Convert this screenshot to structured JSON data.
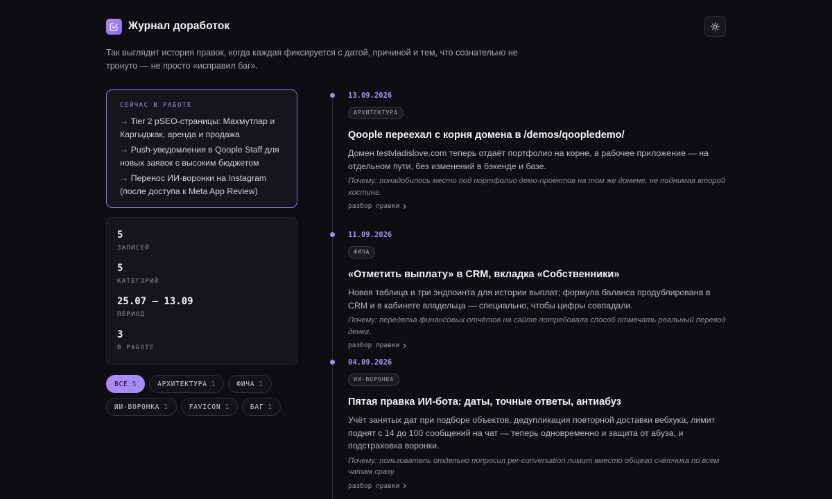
{
  "header": {
    "title": "Журнал доработок",
    "logo_icon": "checklist-edit-icon",
    "theme_icon": "sun-icon"
  },
  "intro": "Так выглядит история правок, когда каждая фиксируется с датой, причиной и тем, что сознательно не тронуто — не просто «исправил баг».",
  "now": {
    "title": "СЕЙЧАС В РАБОТЕ",
    "arrow": "→",
    "items": [
      "Tier 2 pSEO-страницы: Махмутлар и Каргыджак, аренда и продажа",
      "Push-уведомления в Qoople Staff для новых заявок с высоким бюджетом",
      "Перенос ИИ-воронки на Instagram (после доступа к Meta App Review)"
    ]
  },
  "stats": [
    {
      "value": "5",
      "label": "ЗАПИСЕЙ"
    },
    {
      "value": "5",
      "label": "КАТЕГОРИЙ"
    },
    {
      "value": "25.07 — 13.09",
      "label": "ПЕРИОД"
    },
    {
      "value": "3",
      "label": "В РАБОТЕ"
    }
  ],
  "filters": [
    {
      "label": "ВСЕ",
      "count": "5",
      "active": true
    },
    {
      "label": "АРХИТЕКТУРА",
      "count": "1",
      "active": false
    },
    {
      "label": "ФИЧА",
      "count": "1",
      "active": false
    },
    {
      "label": "ИИ-ВОРОНКА",
      "count": "1",
      "active": false
    },
    {
      "label": "FAVICON",
      "count": "1",
      "active": false
    },
    {
      "label": "БАГ",
      "count": "1",
      "active": false
    }
  ],
  "entries": [
    {
      "date": "13.09.2026",
      "tag": "АРХИТЕКТУРА",
      "title": "Qoople переехал с корня домена в /demos/qoopledemo/",
      "text": "Домен testvladislove.com теперь отдаёт портфолио на корне, а рабочее приложение — на отдельном пути, без изменений в бэкенде и базе.",
      "why": "Почему: понадобилось место под портфолио демо-проектов на том же домене, не поднимая второй хостинг.",
      "link": "разбор правки"
    },
    {
      "date": "11.09.2026",
      "tag": "ФИЧА",
      "title": "«Отметить выплату» в CRM, вкладка «Собственники»",
      "text": "Новая таблица и три эндпоинта для истории выплат; формула баланса продублирована в CRM и в кабинете владельца — специально, чтобы цифры совпадали.",
      "why": "Почему: переделка финансовых отчётов на сайте потребовала способ отмечать реальный перевод денег.",
      "link": "разбор правки"
    },
    {
      "date": "04.09.2026",
      "tag": "ИИ-ВОРОНКА",
      "title": "Пятая правка ИИ-бота: даты, точные ответы, антиабуз",
      "text": "Учёт занятых дат при подборе объектов, дедупликация повторной доставки вебхука, лимит поднят с 14 до 100 сообщений на чат — теперь одновременно и защита от абуза, и подстраховка воронки.",
      "why": "Почему: пользователь отдельно попросил per-conversation лимит вместо общего счётчика по всем чатам сразу.",
      "link": "разбор правки"
    }
  ]
}
